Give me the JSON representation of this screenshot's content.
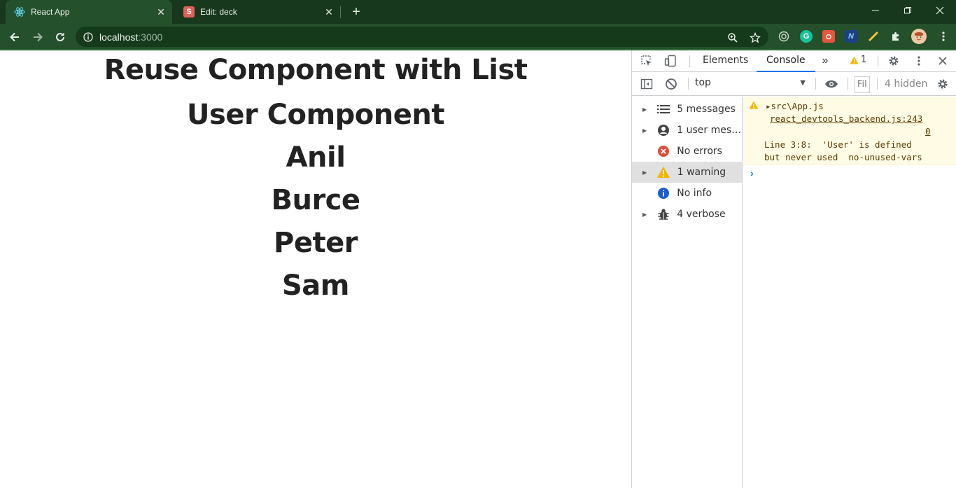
{
  "browser": {
    "tabs": [
      {
        "title": "React App",
        "favicon": "react-icon",
        "active": true
      },
      {
        "title": "Edit: deck",
        "favicon": "slides-icon",
        "favicon_letter": "S",
        "active": false
      }
    ],
    "url_host": "localhost",
    "url_port": ":3000",
    "accent_color": "#24502b"
  },
  "page": {
    "title": "Reuse Component with List",
    "subtitle": "User Component",
    "users": [
      "Anil",
      "Burce",
      "Peter",
      "Sam"
    ]
  },
  "devtools": {
    "tabs": [
      "Elements",
      "Console"
    ],
    "active_tab": "Console",
    "warning_count": "1",
    "context": "top",
    "filter_placeholder": "Fil",
    "hidden_count": "4 hidden",
    "sidebar": [
      {
        "label": "5 messages",
        "icon": "list-icon",
        "expandable": true
      },
      {
        "label": "1 user mess...",
        "icon": "user-icon",
        "expandable": true
      },
      {
        "label": "No errors",
        "icon": "error-icon",
        "expandable": false
      },
      {
        "label": "1 warning",
        "icon": "warning-icon",
        "expandable": true,
        "selected": true
      },
      {
        "label": "No info",
        "icon": "info-icon",
        "expandable": false
      },
      {
        "label": "4 verbose",
        "icon": "bug-icon",
        "expandable": true
      }
    ],
    "console_message": {
      "source": "src\\App.js",
      "link": "react_devtools_backend.js:243",
      "link_suffix": "0",
      "text": "Line 3:8:  'User' is defined\nbut never used  no-unused-vars"
    }
  }
}
